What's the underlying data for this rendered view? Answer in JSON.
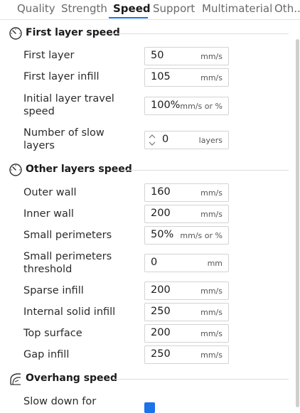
{
  "tabs": [
    {
      "label": "Quality"
    },
    {
      "label": "Strength"
    },
    {
      "label": "Speed"
    },
    {
      "label": "Support"
    },
    {
      "label": "Multimaterial"
    },
    {
      "label": "Oth..."
    }
  ],
  "sections": {
    "first_layer": {
      "title": "First layer speed",
      "rows": [
        {
          "label": "First layer",
          "value": "50",
          "unit": "mm/s"
        },
        {
          "label": "First layer infill",
          "value": "105",
          "unit": "mm/s"
        },
        {
          "label_lines": [
            "Initial layer travel",
            "speed"
          ],
          "value": "100%",
          "unit": "mm/s or %"
        },
        {
          "label_lines": [
            "Number of slow",
            "layers"
          ],
          "value": "0",
          "unit": "layers"
        }
      ]
    },
    "other_layers": {
      "title": "Other layers speed",
      "rows": [
        {
          "label": "Outer wall",
          "value": "160",
          "unit": "mm/s"
        },
        {
          "label": "Inner wall",
          "value": "200",
          "unit": "mm/s"
        },
        {
          "label": "Small perimeters",
          "value": "50%",
          "unit": "mm/s or %"
        },
        {
          "label_lines": [
            "Small perimeters",
            "threshold"
          ],
          "value": "0",
          "unit": "mm"
        },
        {
          "label": "Sparse infill",
          "value": "200",
          "unit": "mm/s"
        },
        {
          "label": "Internal solid infill",
          "value": "250",
          "unit": "mm/s"
        },
        {
          "label": "Top surface",
          "value": "200",
          "unit": "mm/s"
        },
        {
          "label": "Gap infill",
          "value": "250",
          "unit": "mm/s"
        }
      ]
    },
    "overhang": {
      "title": "Overhang speed",
      "rows": [
        {
          "label": "Slow down for",
          "checked": true
        }
      ]
    }
  },
  "colors": {
    "accent": "#1a73e8"
  },
  "icons": {
    "speed_section": "speedometer-icon",
    "overhang_section": "overhang-icon"
  }
}
